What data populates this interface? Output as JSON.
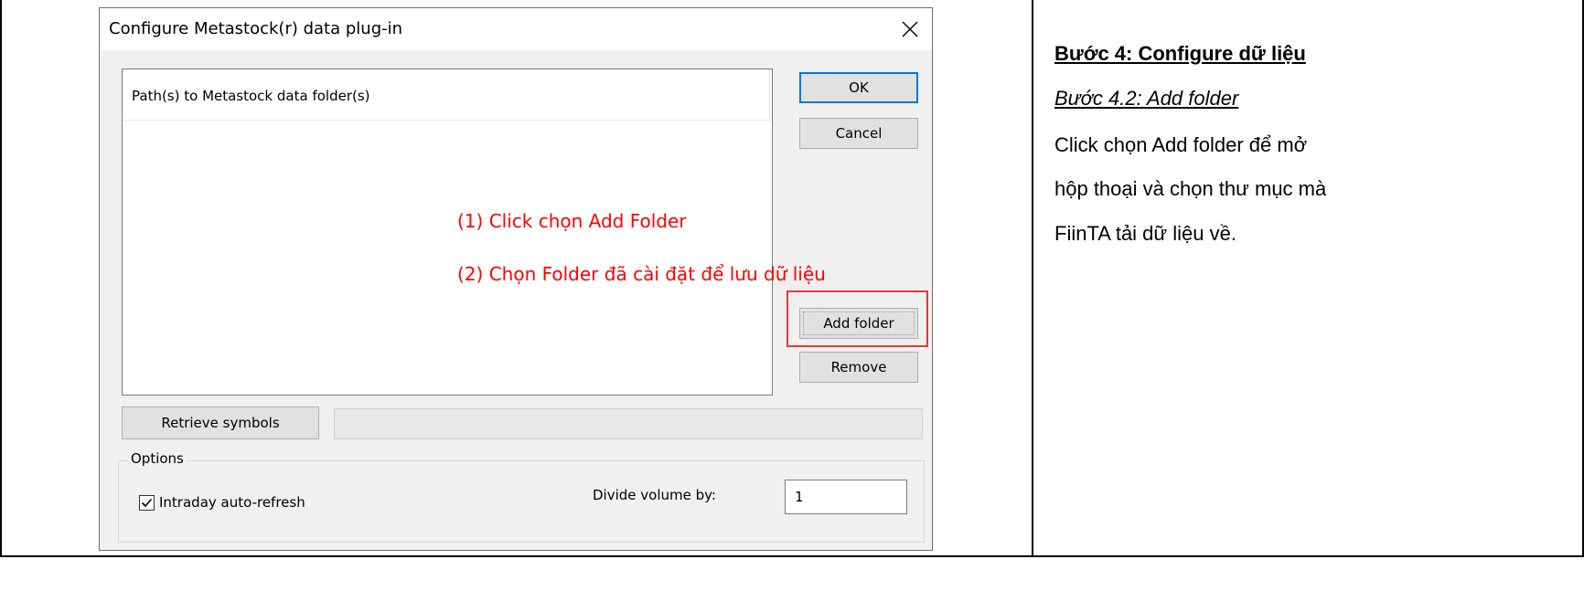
{
  "dialog": {
    "title": "Configure Metastock(r) data plug-in",
    "list_header": "Path(s) to Metastock data folder(s)",
    "buttons": {
      "ok": "OK",
      "cancel": "Cancel",
      "add_folder": "Add folder",
      "remove": "Remove",
      "retrieve_symbols": "Retrieve symbols"
    },
    "options": {
      "group_label": "Options",
      "intraday_label": "Intraday auto-refresh",
      "intraday_checked": true,
      "divide_label": "Divide volume by:",
      "divide_value": "1"
    }
  },
  "annotations": {
    "step1": "(1) Click chọn Add Folder",
    "step2": "(2) Chọn Folder đã cài đặt để lưu dữ liệu",
    "color": "#ff0000"
  },
  "instructions": {
    "heading": "Bước 4: Configure dữ liệu",
    "subheading": "Bước 4.2: Add folder",
    "lines": [
      "Click chọn Add folder để mở",
      "hộp thoại và chọn thư mục mà",
      "FiinTA tải dữ liệu về."
    ]
  },
  "icons": {
    "close": "close-icon",
    "check": "check-icon"
  }
}
